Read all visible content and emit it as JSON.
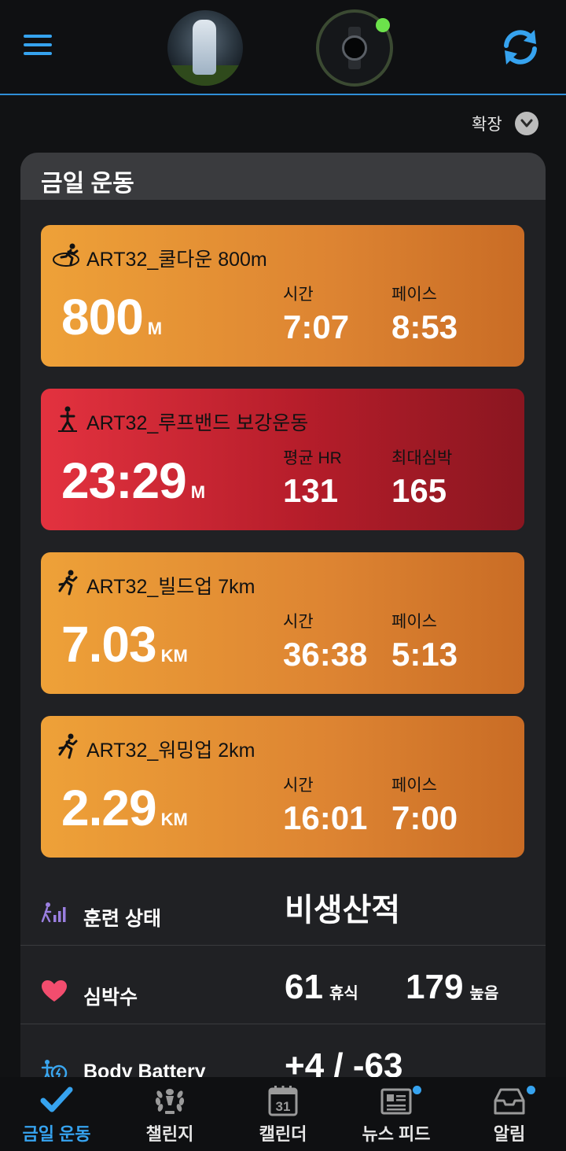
{
  "colors": {
    "accent": "#36a3ef",
    "orange_card": "#e8963a",
    "red_card": "#c8232f",
    "device_connected": "#6ce24b"
  },
  "header": {
    "menu_icon": "hamburger-menu-icon",
    "avatar": "profile-avatar",
    "device_icon": "watch-icon",
    "sync_icon": "sync-icon"
  },
  "expand": {
    "label": "확장",
    "icon": "chevron-down-icon"
  },
  "today": {
    "title": "금일 운동",
    "activities": [
      {
        "icon": "running-track-icon",
        "title": "ART32_쿨다운 800m",
        "value": "800",
        "unit": "M",
        "stat1_label": "시간",
        "stat1_value": "7:07",
        "stat2_label": "페이스",
        "stat2_value": "8:53",
        "color": "orange"
      },
      {
        "icon": "strength-training-icon",
        "title": "ART32_루프밴드 보강운동",
        "value": "23:29",
        "unit": "M",
        "stat1_label": "평균 HR",
        "stat1_value": "131",
        "stat2_label": "최대심박",
        "stat2_value": "165",
        "color": "red"
      },
      {
        "icon": "running-icon",
        "title": "ART32_빌드업 7km",
        "value": "7.03",
        "unit": "KM",
        "stat1_label": "시간",
        "stat1_value": "36:38",
        "stat2_label": "페이스",
        "stat2_value": "5:13",
        "color": "orange"
      },
      {
        "icon": "running-icon",
        "title": "ART32_워밍업 2km",
        "value": "2.29",
        "unit": "KM",
        "stat1_label": "시간",
        "stat1_value": "16:01",
        "stat2_label": "페이스",
        "stat2_value": "7:00",
        "color": "orange"
      }
    ]
  },
  "metrics": {
    "training_status": {
      "icon": "training-status-icon",
      "label": "훈련 상태",
      "value": "비생산적"
    },
    "heart_rate": {
      "icon": "heart-icon",
      "label": "심박수",
      "resting": "61",
      "resting_label": "휴식",
      "high": "179",
      "high_label": "높음"
    },
    "body_battery": {
      "icon": "body-battery-icon",
      "label": "Body Battery",
      "value": "+4 / -63"
    }
  },
  "bottom_nav": [
    {
      "label": "금일 운동",
      "icon": "checkmark-icon",
      "active": true
    },
    {
      "label": "챌린지",
      "icon": "laurel-icon",
      "active": false
    },
    {
      "label": "캘린더",
      "icon": "calendar-icon",
      "calendar_day": "31",
      "active": false
    },
    {
      "label": "뉴스 피드",
      "icon": "newsfeed-icon",
      "active": false,
      "badge": true
    },
    {
      "label": "알림",
      "icon": "inbox-icon",
      "active": false,
      "badge": true
    }
  ]
}
